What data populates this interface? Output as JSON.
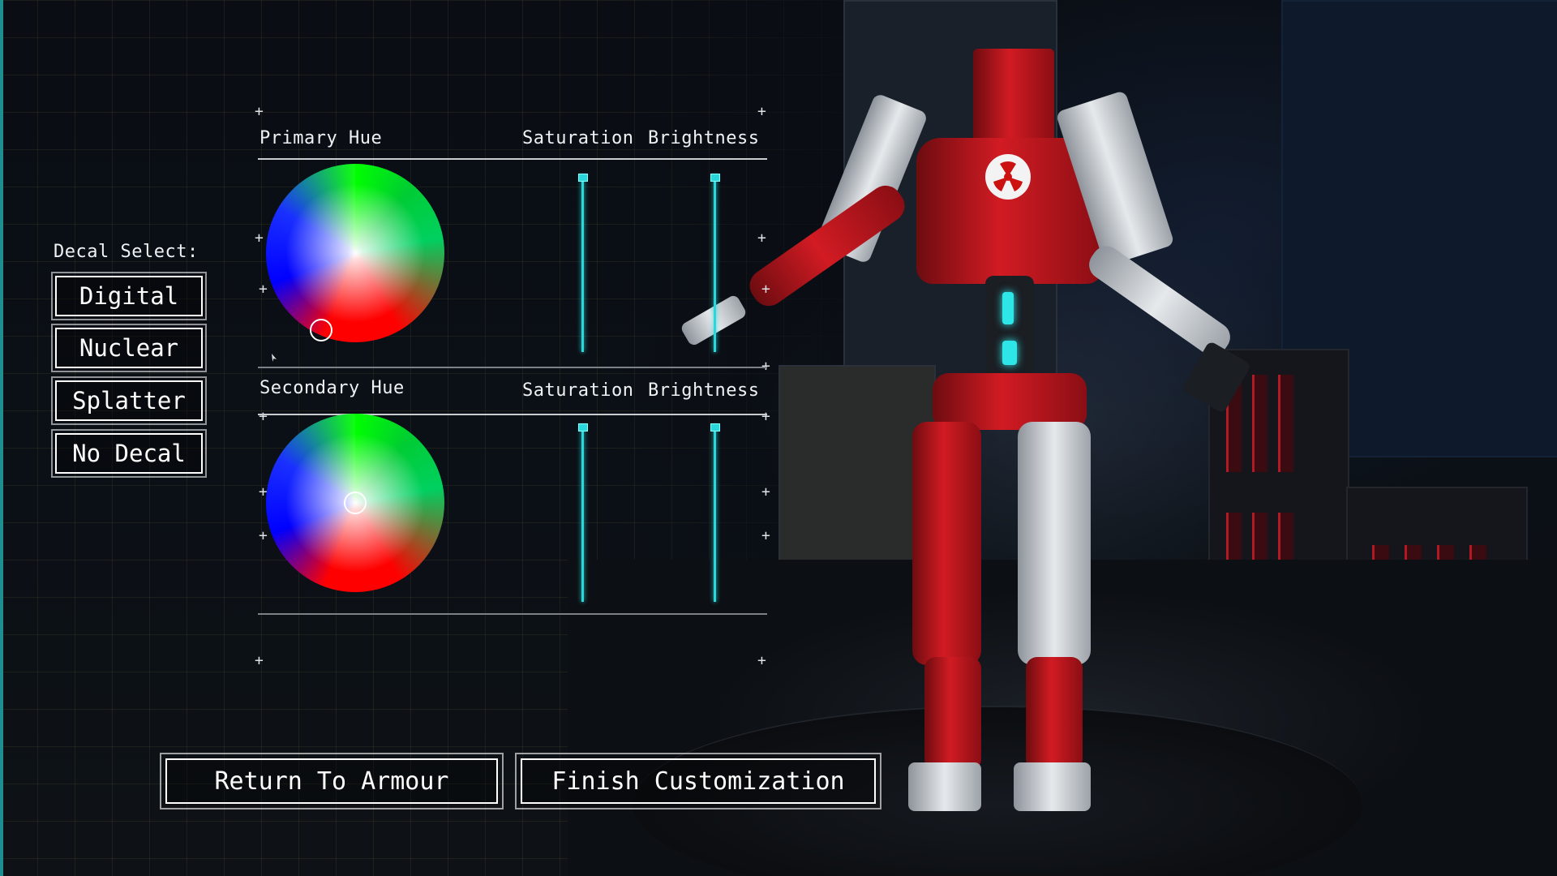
{
  "primary": {
    "hue_label": "Primary Hue",
    "saturation_label": "Saturation",
    "brightness_label": "Brightness"
  },
  "secondary": {
    "hue_label": "Secondary Hue",
    "saturation_label": "Saturation",
    "brightness_label": "Brightness"
  },
  "decal": {
    "title": "Decal Select:",
    "options": [
      "Digital",
      "Nuclear",
      "Splatter",
      "No Decal"
    ]
  },
  "actions": {
    "return_label": "Return To Armour",
    "finish_label": "Finish Customization"
  },
  "colors": {
    "accent": "#2ad7da",
    "armor_primary": "#d21b23",
    "armor_secondary": "#e6e9ec"
  },
  "icons": {
    "color_wheel": "hsv-wheel",
    "picker": "ring-cursor",
    "corner_marker": "plus-icon"
  }
}
